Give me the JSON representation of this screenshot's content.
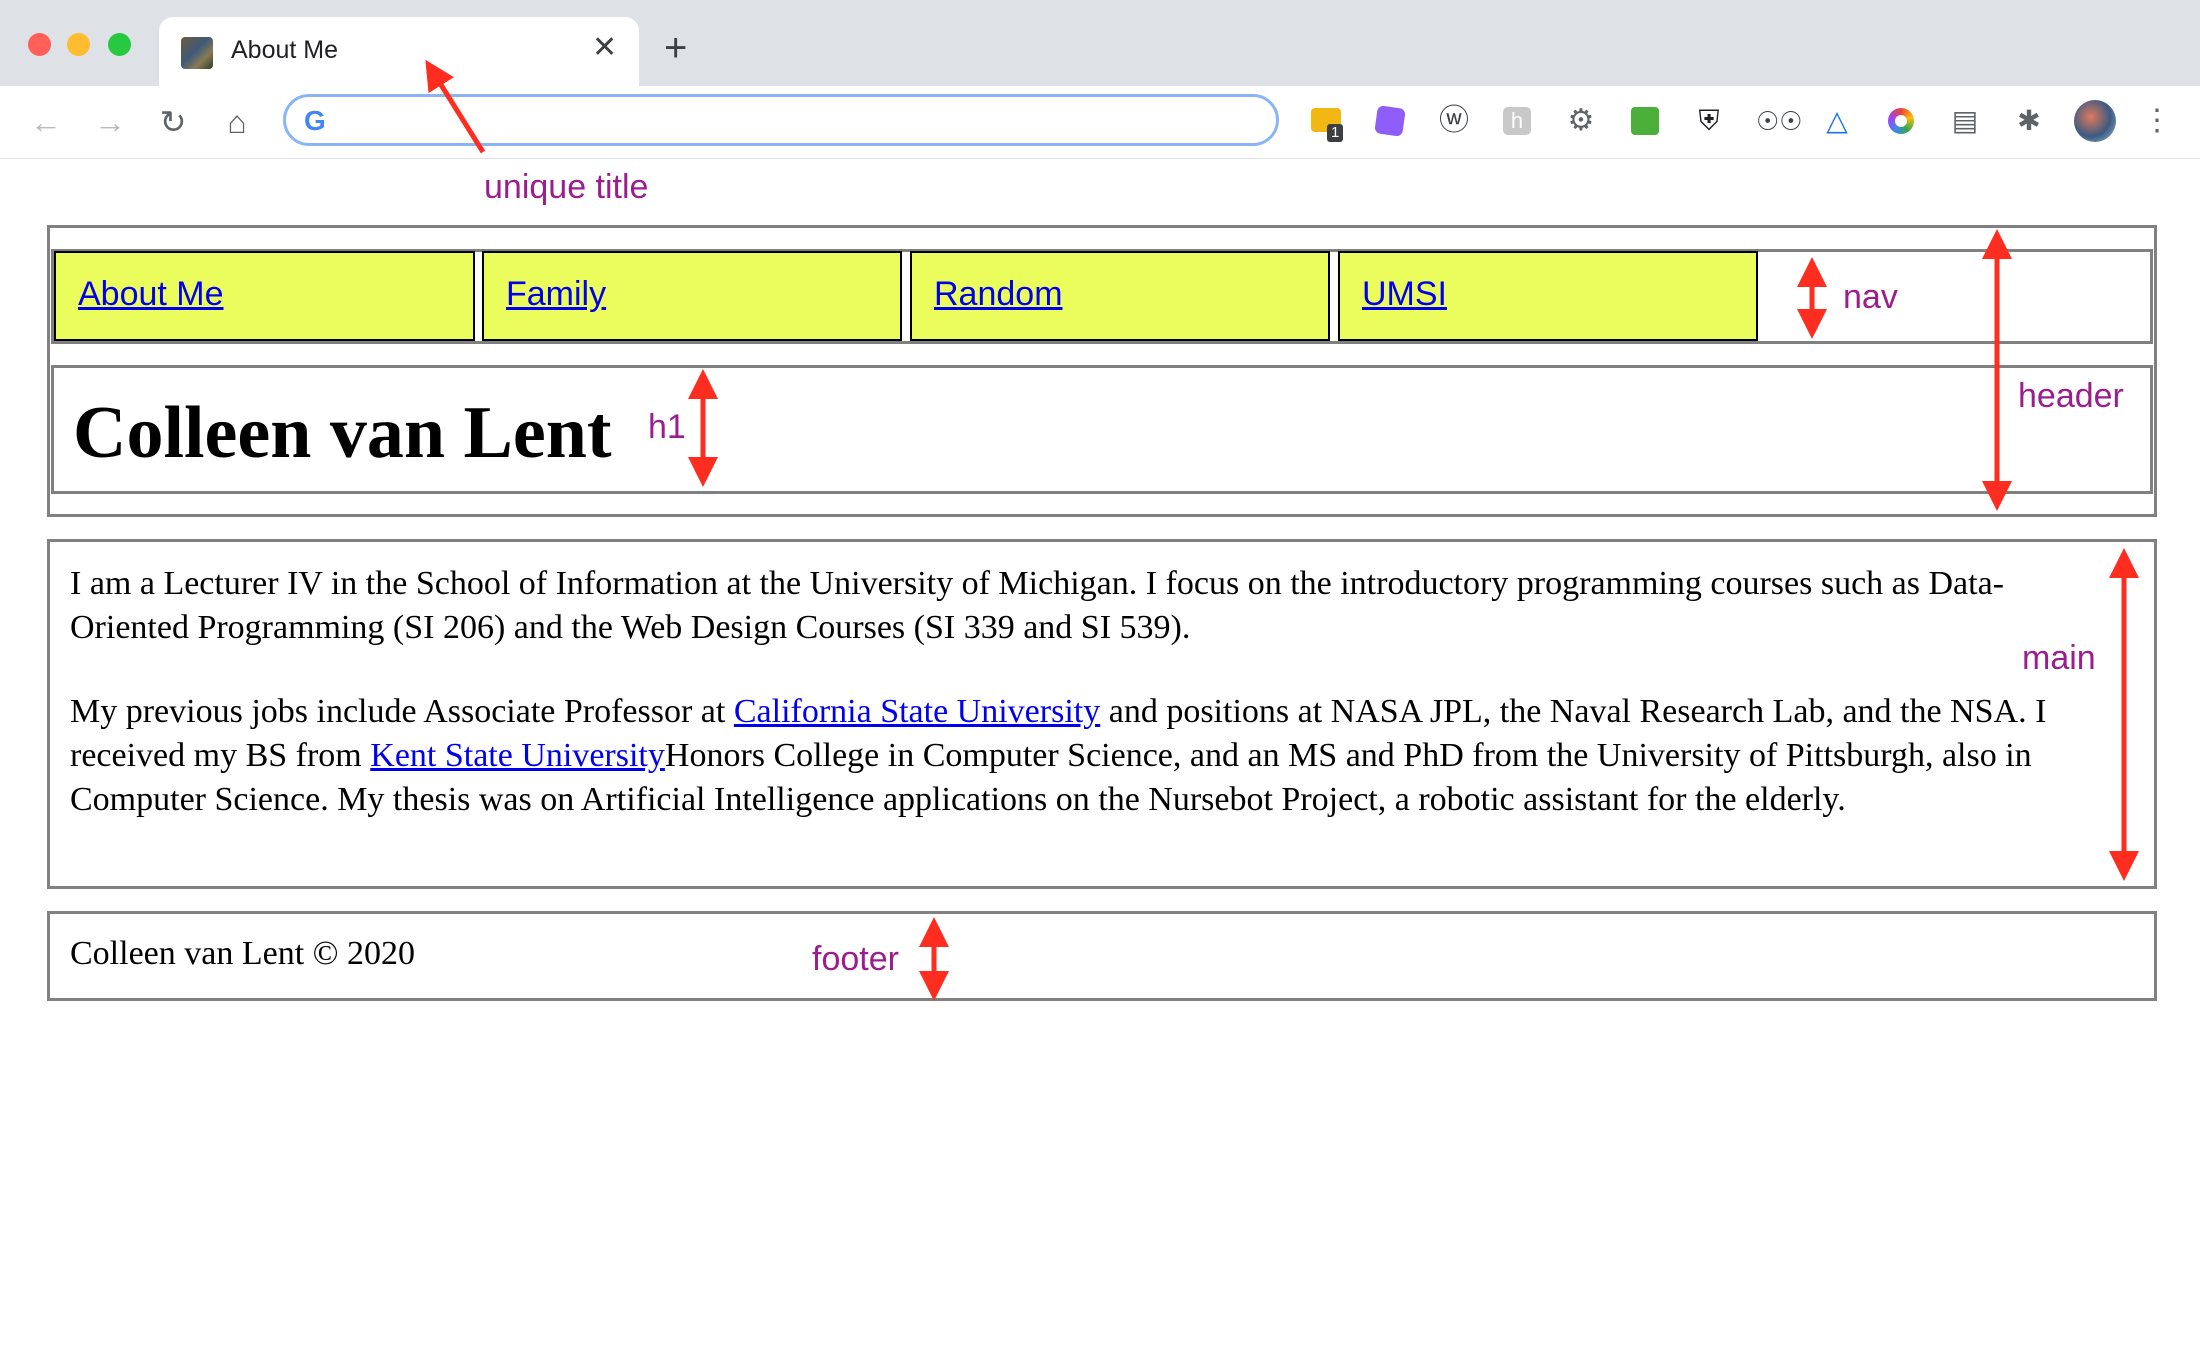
{
  "browser": {
    "tab_title": "About Me",
    "tab_close": "✕",
    "new_tab": "+",
    "omnibox_value": "",
    "google_logo": "G",
    "extension_badge": "1"
  },
  "nav": {
    "items": [
      {
        "label": "About Me"
      },
      {
        "label": "Family"
      },
      {
        "label": "Random"
      },
      {
        "label": "UMSI"
      }
    ]
  },
  "header": {
    "h1": "Colleen van Lent"
  },
  "main": {
    "p1": "I am a Lecturer IV in the School of Information at the University of Michigan. I focus on the introductory programming courses such as Data-Oriented Programming (SI 206) and the Web Design Courses (SI 339 and SI 539).",
    "p2_before": "My previous jobs include Associate Professor at ",
    "p2_link1": "California State University",
    "p2_middle": " and positions at NASA JPL, the Naval Research Lab, and the NSA. I received my BS from ",
    "p2_link2": "Kent State University",
    "p2_after": "Honors College in Computer Science, and an MS and PhD from the University of Pittsburgh, also in Computer Science. My thesis was on Artificial Intelligence applications on the Nursebot Project, a robotic assistant for the elderly."
  },
  "footer": {
    "text": "Colleen van Lent © 2020"
  },
  "annotations": {
    "unique_title": "unique title",
    "nav": "nav",
    "header": "header",
    "h1": "h1",
    "main": "main",
    "footer": "footer"
  },
  "colors": {
    "nav_background": "#ebfd5c",
    "annotation_text": "#9b1e8f",
    "annotation_arrow": "#ff2d1f",
    "link": "#0000ee"
  }
}
